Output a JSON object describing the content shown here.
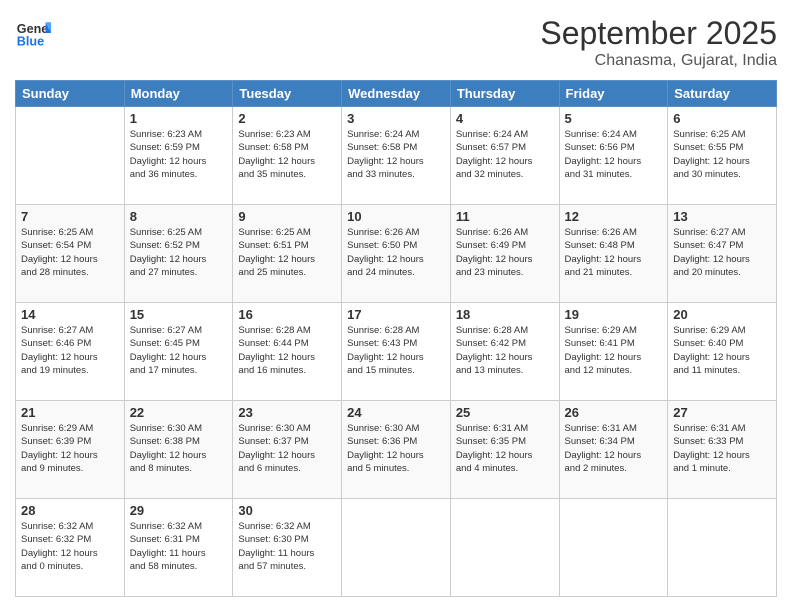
{
  "header": {
    "logo_line1": "General",
    "logo_line2": "Blue",
    "month": "September 2025",
    "location": "Chanasma, Gujarat, India"
  },
  "weekdays": [
    "Sunday",
    "Monday",
    "Tuesday",
    "Wednesday",
    "Thursday",
    "Friday",
    "Saturday"
  ],
  "weeks": [
    [
      {
        "day": "",
        "info": ""
      },
      {
        "day": "1",
        "info": "Sunrise: 6:23 AM\nSunset: 6:59 PM\nDaylight: 12 hours\nand 36 minutes."
      },
      {
        "day": "2",
        "info": "Sunrise: 6:23 AM\nSunset: 6:58 PM\nDaylight: 12 hours\nand 35 minutes."
      },
      {
        "day": "3",
        "info": "Sunrise: 6:24 AM\nSunset: 6:58 PM\nDaylight: 12 hours\nand 33 minutes."
      },
      {
        "day": "4",
        "info": "Sunrise: 6:24 AM\nSunset: 6:57 PM\nDaylight: 12 hours\nand 32 minutes."
      },
      {
        "day": "5",
        "info": "Sunrise: 6:24 AM\nSunset: 6:56 PM\nDaylight: 12 hours\nand 31 minutes."
      },
      {
        "day": "6",
        "info": "Sunrise: 6:25 AM\nSunset: 6:55 PM\nDaylight: 12 hours\nand 30 minutes."
      }
    ],
    [
      {
        "day": "7",
        "info": "Sunrise: 6:25 AM\nSunset: 6:54 PM\nDaylight: 12 hours\nand 28 minutes."
      },
      {
        "day": "8",
        "info": "Sunrise: 6:25 AM\nSunset: 6:52 PM\nDaylight: 12 hours\nand 27 minutes."
      },
      {
        "day": "9",
        "info": "Sunrise: 6:25 AM\nSunset: 6:51 PM\nDaylight: 12 hours\nand 25 minutes."
      },
      {
        "day": "10",
        "info": "Sunrise: 6:26 AM\nSunset: 6:50 PM\nDaylight: 12 hours\nand 24 minutes."
      },
      {
        "day": "11",
        "info": "Sunrise: 6:26 AM\nSunset: 6:49 PM\nDaylight: 12 hours\nand 23 minutes."
      },
      {
        "day": "12",
        "info": "Sunrise: 6:26 AM\nSunset: 6:48 PM\nDaylight: 12 hours\nand 21 minutes."
      },
      {
        "day": "13",
        "info": "Sunrise: 6:27 AM\nSunset: 6:47 PM\nDaylight: 12 hours\nand 20 minutes."
      }
    ],
    [
      {
        "day": "14",
        "info": "Sunrise: 6:27 AM\nSunset: 6:46 PM\nDaylight: 12 hours\nand 19 minutes."
      },
      {
        "day": "15",
        "info": "Sunrise: 6:27 AM\nSunset: 6:45 PM\nDaylight: 12 hours\nand 17 minutes."
      },
      {
        "day": "16",
        "info": "Sunrise: 6:28 AM\nSunset: 6:44 PM\nDaylight: 12 hours\nand 16 minutes."
      },
      {
        "day": "17",
        "info": "Sunrise: 6:28 AM\nSunset: 6:43 PM\nDaylight: 12 hours\nand 15 minutes."
      },
      {
        "day": "18",
        "info": "Sunrise: 6:28 AM\nSunset: 6:42 PM\nDaylight: 12 hours\nand 13 minutes."
      },
      {
        "day": "19",
        "info": "Sunrise: 6:29 AM\nSunset: 6:41 PM\nDaylight: 12 hours\nand 12 minutes."
      },
      {
        "day": "20",
        "info": "Sunrise: 6:29 AM\nSunset: 6:40 PM\nDaylight: 12 hours\nand 11 minutes."
      }
    ],
    [
      {
        "day": "21",
        "info": "Sunrise: 6:29 AM\nSunset: 6:39 PM\nDaylight: 12 hours\nand 9 minutes."
      },
      {
        "day": "22",
        "info": "Sunrise: 6:30 AM\nSunset: 6:38 PM\nDaylight: 12 hours\nand 8 minutes."
      },
      {
        "day": "23",
        "info": "Sunrise: 6:30 AM\nSunset: 6:37 PM\nDaylight: 12 hours\nand 6 minutes."
      },
      {
        "day": "24",
        "info": "Sunrise: 6:30 AM\nSunset: 6:36 PM\nDaylight: 12 hours\nand 5 minutes."
      },
      {
        "day": "25",
        "info": "Sunrise: 6:31 AM\nSunset: 6:35 PM\nDaylight: 12 hours\nand 4 minutes."
      },
      {
        "day": "26",
        "info": "Sunrise: 6:31 AM\nSunset: 6:34 PM\nDaylight: 12 hours\nand 2 minutes."
      },
      {
        "day": "27",
        "info": "Sunrise: 6:31 AM\nSunset: 6:33 PM\nDaylight: 12 hours\nand 1 minute."
      }
    ],
    [
      {
        "day": "28",
        "info": "Sunrise: 6:32 AM\nSunset: 6:32 PM\nDaylight: 12 hours\nand 0 minutes."
      },
      {
        "day": "29",
        "info": "Sunrise: 6:32 AM\nSunset: 6:31 PM\nDaylight: 11 hours\nand 58 minutes."
      },
      {
        "day": "30",
        "info": "Sunrise: 6:32 AM\nSunset: 6:30 PM\nDaylight: 11 hours\nand 57 minutes."
      },
      {
        "day": "",
        "info": ""
      },
      {
        "day": "",
        "info": ""
      },
      {
        "day": "",
        "info": ""
      },
      {
        "day": "",
        "info": ""
      }
    ]
  ]
}
